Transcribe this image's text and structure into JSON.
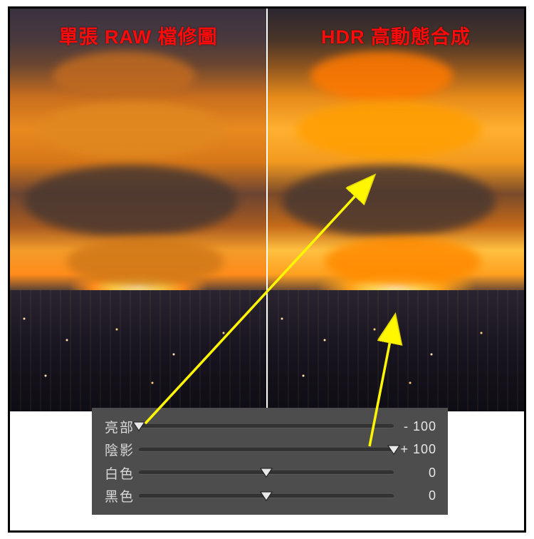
{
  "comparison": {
    "left_title": "單張 RAW 檔修圖",
    "right_title": "HDR 高動態合成"
  },
  "sliders": [
    {
      "id": "highlights",
      "label": "亮部",
      "value": -100,
      "display": "- 100",
      "position_pct": 0
    },
    {
      "id": "shadows",
      "label": "陰影",
      "value": 100,
      "display": "+ 100",
      "position_pct": 100
    },
    {
      "id": "whites",
      "label": "白色",
      "value": 0,
      "display": "0",
      "position_pct": 50
    },
    {
      "id": "blacks",
      "label": "黑色",
      "value": 0,
      "display": "0",
      "position_pct": 50
    }
  ],
  "arrows": [
    {
      "from": "highlights-thumb",
      "to": "right-image-sky"
    },
    {
      "from": "shadows-thumb",
      "to": "right-image-city"
    }
  ],
  "colors": {
    "title_red": "#ff0a0a",
    "panel_bg": "#4d4d4d",
    "arrow_yellow": "#fff700"
  }
}
